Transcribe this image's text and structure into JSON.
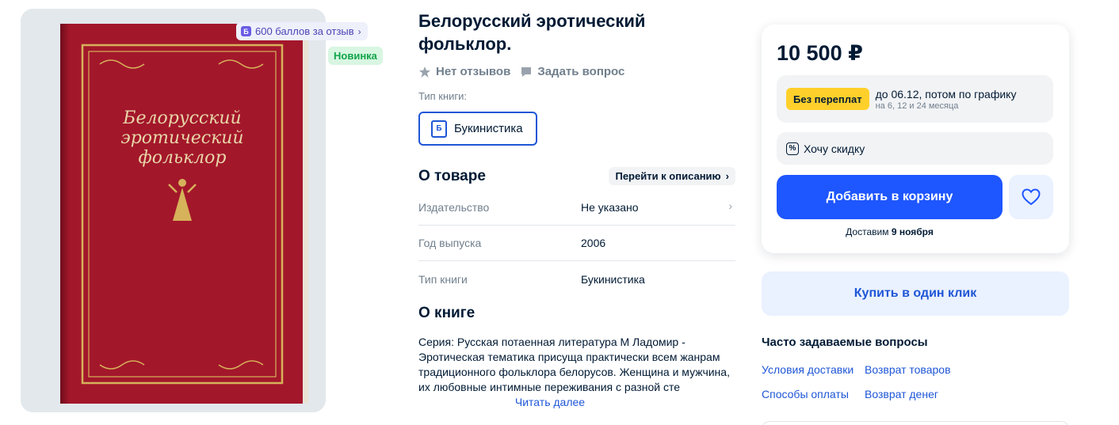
{
  "gallery": {
    "points_badge": "600 баллов за отзыв",
    "points_icon_letter": "Б",
    "new_badge": "Новинка",
    "cover_title_lines": [
      "Белорусский",
      "эротический",
      "фольклор"
    ]
  },
  "product": {
    "title": "Белорусский эротический фольклор.",
    "reviews": "Нет отзывов",
    "ask": "Задать вопрос",
    "type_label": "Тип книги:",
    "type_value": "Букинистика",
    "type_icon_letter": "Б"
  },
  "about": {
    "heading": "О товаре",
    "go_description": "Перейти к описанию",
    "props": [
      {
        "key": "Издательство",
        "value": "Не указано"
      },
      {
        "key": "Год выпуска",
        "value": "2006"
      },
      {
        "key": "Тип книги",
        "value": "Букинистика"
      }
    ]
  },
  "book": {
    "heading": "О книге",
    "description": "Серия: Русская потаенная литература М Ладомир - Эротическая тематика присуща практически всем жанрам традиционного фольклора белорусов. Женщина и мужчина, их любовные интимные переживания с разной сте",
    "read_more": "Читать далее"
  },
  "buy": {
    "price": "10 500 ₽",
    "installment_badge": "Без переплат",
    "installment_text": "до 06.12, потом по графику",
    "installment_sub": "на 6, 12 и 24 месяца",
    "discount": "Хочу скидку",
    "add_to_cart": "Добавить в корзину",
    "delivery_prefix": "Доставим",
    "delivery_date": "9 ноября",
    "one_click": "Купить в один клик"
  },
  "faq": {
    "title": "Часто задаваемые вопросы",
    "links": [
      "Условия доставки",
      "Возврат товаров",
      "Способы оплаты",
      "Возврат денег"
    ]
  },
  "colors": {
    "accent": "#1e56ff",
    "cover_red": "#a3172b",
    "gold": "#d6b25a"
  }
}
